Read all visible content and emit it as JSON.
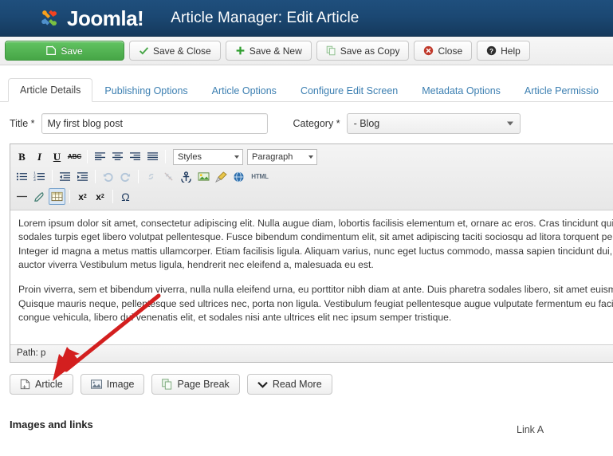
{
  "header": {
    "logo_text": "Joomla!",
    "logo_icon": "joomla-logo-icon",
    "title": "Article Manager: Edit Article",
    "bg_color": "#1b4873"
  },
  "toolbar": {
    "buttons": [
      {
        "label": "Save",
        "icon": "save-disk-icon",
        "style": "primary"
      },
      {
        "label": "Save & Close",
        "icon": "check-icon",
        "style": "default"
      },
      {
        "label": "Save & New",
        "icon": "plus-icon",
        "style": "default"
      },
      {
        "label": "Save as Copy",
        "icon": "copy-icon",
        "style": "default"
      },
      {
        "label": "Close",
        "icon": "cancel-circle-icon",
        "style": "default"
      },
      {
        "label": "Help",
        "icon": "question-circle-icon",
        "style": "default"
      }
    ],
    "primary_color": "#46a546"
  },
  "tabs": [
    {
      "label": "Article Details",
      "active": true
    },
    {
      "label": "Publishing Options",
      "active": false
    },
    {
      "label": "Article Options",
      "active": false
    },
    {
      "label": "Configure Edit Screen",
      "active": false
    },
    {
      "label": "Metadata Options",
      "active": false
    },
    {
      "label": "Article Permissio",
      "active": false
    }
  ],
  "fields": {
    "title_label": "Title *",
    "title_value": "My first blog post",
    "title_placeholder": "",
    "category_label": "Category *",
    "category_value": "- Blog"
  },
  "editor": {
    "row1": {
      "bold": "B",
      "italic": "I",
      "underline": "U",
      "strikethrough": "ABC",
      "align_left": "align-left-icon",
      "align_center": "align-center-icon",
      "align_right": "align-right-icon",
      "align_justify": "align-justify-icon",
      "styles_select": "Styles",
      "paragraph_select": "Paragraph"
    },
    "row2": {
      "bullet_list": "bullet-list-icon",
      "numbered_list": "numbered-list-icon",
      "outdent": "outdent-icon",
      "indent": "indent-icon",
      "undo": "undo-icon",
      "redo": "redo-icon",
      "link": "link-icon",
      "unlink": "unlink-icon",
      "anchor": "anchor-icon",
      "image": "image-icon",
      "cleanup": "paintbrush-icon",
      "help": "globe-help-icon",
      "html": "HTML"
    },
    "row3": {
      "horizontal_rule": "horizontal-rule-icon",
      "remove_format": "eraser-icon",
      "table": "table-icon",
      "subscript": "subscript-icon",
      "superscript": "superscript-icon",
      "special_char": "omega-icon"
    },
    "content": {
      "paragraph1": "Lorem ipsum dolor sit amet, consectetur adipiscing elit. Nulla augue diam, lobortis facilisis elementum et, ornare ac eros. Cras tincidunt quis consectetur sit amet metus. Phasellus sodales turpis eget libero volutpat pellentesque. Fusce bibendum condimentum elit, sit amet adipiscing taciti sociosqu ad litora torquent per conubia nostra, per inceptos himenaeos. Integer id magna a metus mattis ullamcorper. Etiam facilisis ligula. Aliquam varius, nunc eget luctus commodo, massa sapien tincidunt dui, ac commodo nibh dui sit amet augue. Aenean auctor viverra Vestibulum metus ligula, hendrerit nec eleifend a, malesuada eu est.",
      "paragraph2": "Proin viverra, sem et bibendum viverra, nulla nulla eleifend urna, eu porttitor nibh diam at ante. Duis pharetra sodales libero, sit amet euismod Praesent semper vestibulum mollis. Quisque mauris neque, pellentesque sed ultrices nec, porta non ligula. Vestibulum feugiat pellentesque augue vulputate fermentum eu facilisis arcu. Vestibulum bibendum, sem eget congue vehicula, libero dui venenatis elit, et sodales nisi ante ultrices elit nec ipsum semper tristique."
    },
    "status_path": "Path: p"
  },
  "insert_buttons": [
    {
      "label": "Article",
      "icon": "article-icon"
    },
    {
      "label": "Image",
      "icon": "image-icon"
    },
    {
      "label": "Page Break",
      "icon": "page-break-icon"
    },
    {
      "label": "Read More",
      "icon": "chevron-down-icon"
    }
  ],
  "footer": {
    "section_title": "Images and links",
    "link_a": "Link A"
  },
  "annotation": {
    "arrow_color": "#d31f1f"
  }
}
